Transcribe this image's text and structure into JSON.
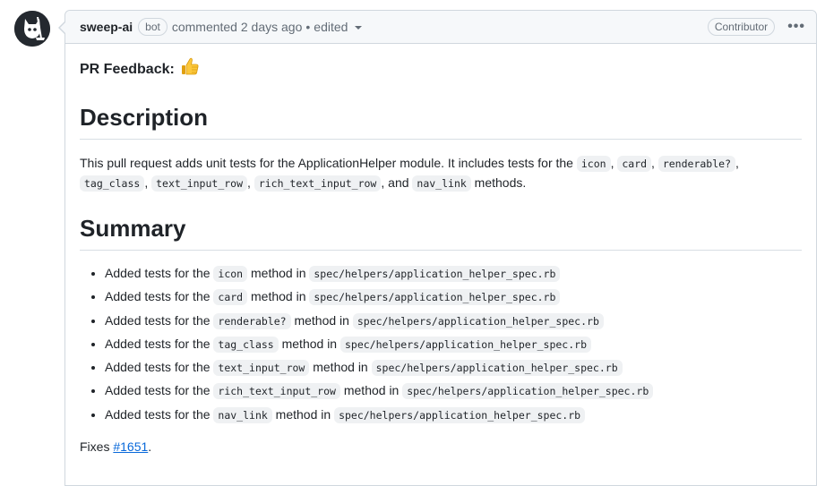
{
  "comment": {
    "author": "sweep-ai",
    "bot_badge": "bot",
    "action": "commented",
    "time": "2 days ago",
    "separator": "•",
    "edited": "edited",
    "role_badge": "Contributor",
    "more": "•••"
  },
  "body": {
    "feedback_label": "PR Feedback:",
    "feedback_emoji": "thumbs-up",
    "description_heading": "Description",
    "description": {
      "t1": "This pull request adds unit tests for the ApplicationHelper module. It includes tests for the ",
      "c1": "icon",
      "s1": ", ",
      "c2": "card",
      "s2": ", ",
      "c3": "renderable?",
      "s3": ",",
      "c4": "tag_class",
      "s4": ", ",
      "c5": "text_input_row",
      "s5": ", ",
      "c6": "rich_text_input_row",
      "s6": ", and ",
      "c7": "nav_link",
      "t2": " methods."
    },
    "summary_heading": "Summary",
    "summary_items": [
      {
        "pre": "Added tests for the ",
        "method": "icon",
        "mid": " method in ",
        "path": "spec/helpers/application_helper_spec.rb"
      },
      {
        "pre": "Added tests for the ",
        "method": "card",
        "mid": " method in ",
        "path": "spec/helpers/application_helper_spec.rb"
      },
      {
        "pre": "Added tests for the ",
        "method": "renderable?",
        "mid": " method in ",
        "path": "spec/helpers/application_helper_spec.rb"
      },
      {
        "pre": "Added tests for the ",
        "method": "tag_class",
        "mid": " method in ",
        "path": "spec/helpers/application_helper_spec.rb"
      },
      {
        "pre": "Added tests for the ",
        "method": "text_input_row",
        "mid": " method in ",
        "path": "spec/helpers/application_helper_spec.rb"
      },
      {
        "pre": "Added tests for the ",
        "method": "rich_text_input_row",
        "mid": " method in ",
        "path": "spec/helpers/application_helper_spec.rb"
      },
      {
        "pre": "Added tests for the ",
        "method": "nav_link",
        "mid": " method in ",
        "path": "spec/helpers/application_helper_spec.rb"
      }
    ],
    "fixes_label": "Fixes ",
    "fixes_link": "#1651",
    "fixes_end": "."
  },
  "colors": {
    "link": "#0969da",
    "header_bg": "#f6f8fa",
    "border": "#d0d7de",
    "code_bg": "#eff1f3"
  }
}
